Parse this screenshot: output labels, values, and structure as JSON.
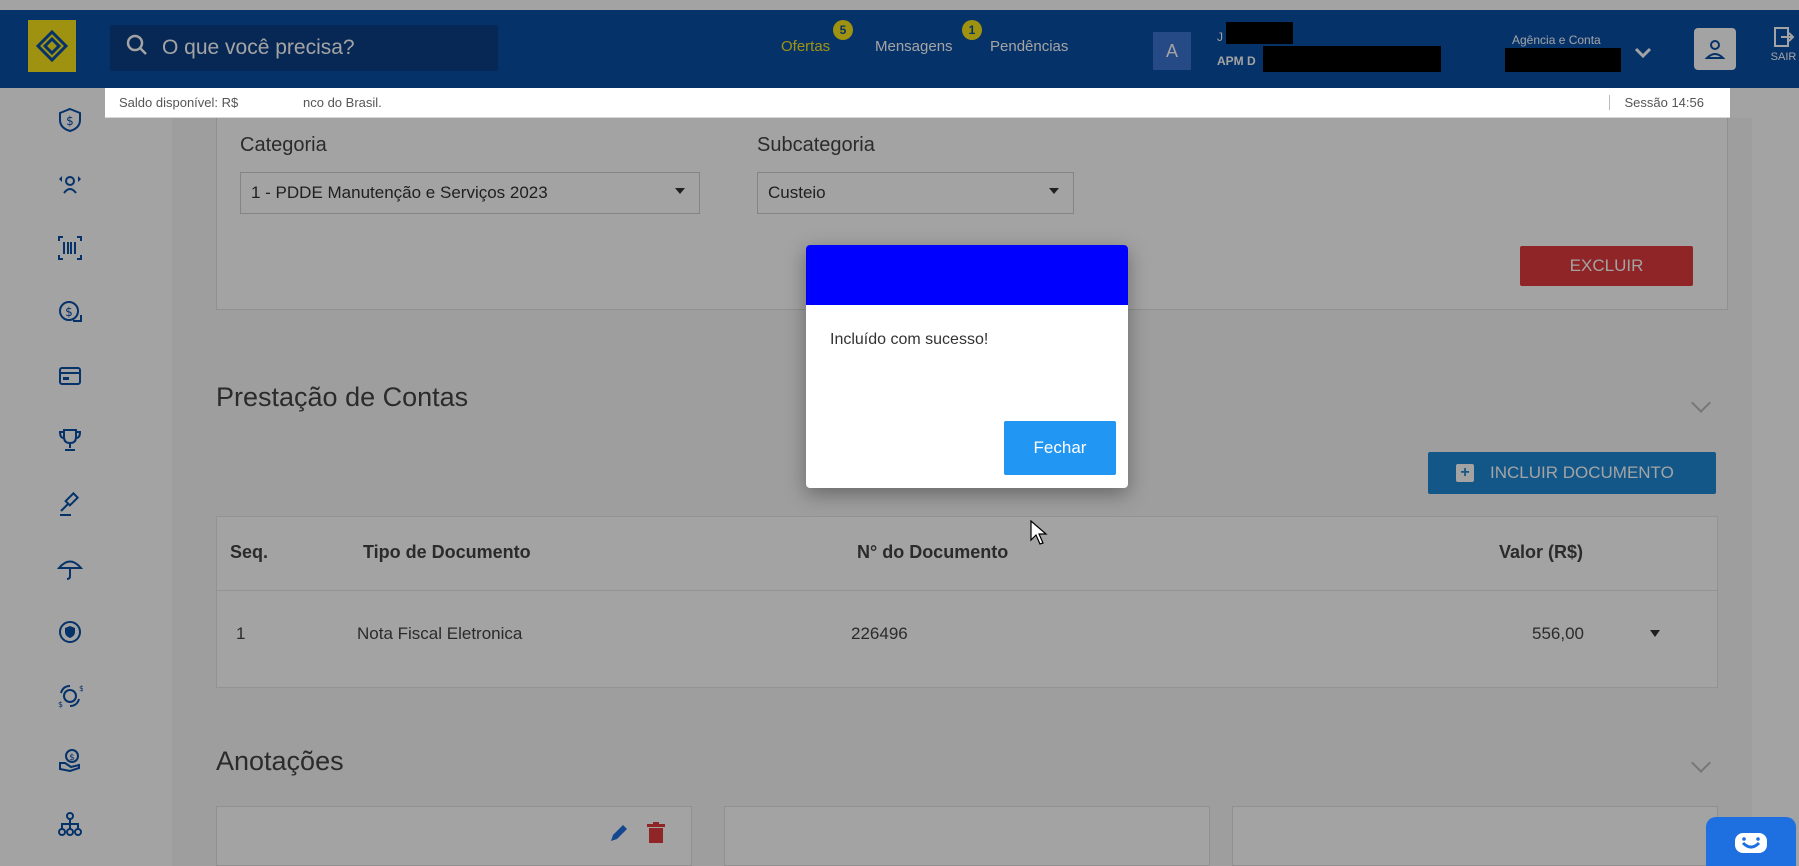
{
  "header": {
    "search_placeholder": "O que você precisa?",
    "nav": [
      {
        "label": "Ofertas",
        "badge": "5"
      },
      {
        "label": "Mensagens",
        "badge": "1"
      },
      {
        "label": "Pendências",
        "badge": ""
      }
    ],
    "avatar_letter": "A",
    "user_line1": "J",
    "user_line2": "APM D",
    "agencia_label": "Agência e Conta",
    "sair_label": "SAIR"
  },
  "info_strip": {
    "saldo": "Saldo disponível: R$",
    "banco": "nco do Brasil.",
    "sessao": "Sessão 14:56"
  },
  "sidebar": {
    "icons": [
      "dollar-shield-icon",
      "transfer-icon",
      "barcode-icon",
      "dollar-arrow-icon",
      "card-icon",
      "trophy-icon",
      "gavel-icon",
      "umbrella-icon",
      "shield-icon",
      "exchange-icon",
      "hand-coin-icon",
      "network-icon"
    ]
  },
  "form": {
    "categoria_label": "Categoria",
    "categoria_value": "1 - PDDE Manutenção e Serviços 2023",
    "subcategoria_label": "Subcategoria",
    "subcategoria_value": "Custeio",
    "excluir_label": "EXCLUIR"
  },
  "prestacao": {
    "title": "Prestação de Contas",
    "incluir_label": "INCLUIR DOCUMENTO",
    "columns": [
      "Seq.",
      "Tipo de Documento",
      "N° do Documento",
      "Valor (R$)"
    ],
    "rows": [
      {
        "seq": "1",
        "tipo": "Nota Fiscal Eletronica",
        "numero": "226496",
        "valor": "556,00"
      }
    ]
  },
  "anotacoes": {
    "title": "Anotações"
  },
  "modal": {
    "message": "Incluído com sucesso!",
    "button_label": "Fechar"
  },
  "colors": {
    "brand_blue": "#0a4fa6",
    "brand_yellow": "#f9e51a",
    "danger": "#e03a3e",
    "primary_button": "#2196f3",
    "modal_header": "#0000ff"
  }
}
